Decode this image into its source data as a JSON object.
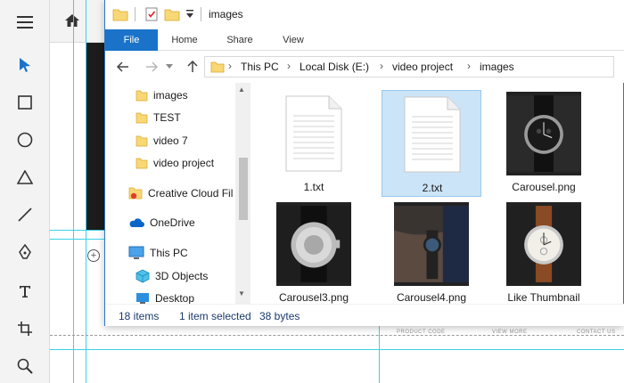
{
  "window": {
    "title": "images",
    "ribbon_tabs": [
      "File",
      "Home",
      "Share",
      "View"
    ]
  },
  "address": {
    "crumbs": [
      "This PC",
      "Local Disk (E:)",
      "video project",
      "images"
    ]
  },
  "nav_pane": {
    "items": [
      {
        "label": "images",
        "icon": "folder-icon"
      },
      {
        "label": "TEST",
        "icon": "folder-icon"
      },
      {
        "label": "video 7",
        "icon": "folder-icon"
      },
      {
        "label": "video project",
        "icon": "folder-icon"
      },
      {
        "label": "Creative Cloud Fil",
        "icon": "creative-cloud-icon"
      },
      {
        "label": "OneDrive",
        "icon": "onedrive-icon"
      },
      {
        "label": "This PC",
        "icon": "computer-icon"
      },
      {
        "label": "3D Objects",
        "icon": "cube-icon"
      },
      {
        "label": "Desktop",
        "icon": "desktop-icon"
      }
    ]
  },
  "files": [
    {
      "name": "1.txt",
      "type": "text",
      "selected": false
    },
    {
      "name": "2.txt",
      "type": "text",
      "selected": true
    },
    {
      "name": "Carousel.png",
      "type": "image",
      "selected": false
    },
    {
      "name": "Carousel3.png",
      "type": "image",
      "selected": false
    },
    {
      "name": "Carousel4.png",
      "type": "image",
      "selected": false
    },
    {
      "name": "Like Thumbnail",
      "type": "image",
      "selected": false
    }
  ],
  "status": {
    "count": "18 items",
    "selection": "1 item selected",
    "size": "38 bytes"
  },
  "canvas_labels": [
    "PRODUCT CODE",
    "VIEW MORE",
    "CONTACT US"
  ],
  "colors": {
    "accent": "#1a73c9",
    "selection": "#cce4f7",
    "guide": "#39d3e6",
    "folder": "#f8d775"
  }
}
